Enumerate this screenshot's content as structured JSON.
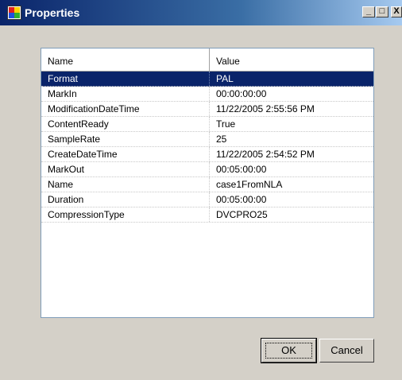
{
  "window": {
    "title": "Properties",
    "controls": {
      "minimize": "_",
      "maximize": "□",
      "close": "X"
    }
  },
  "grid": {
    "columns": [
      "Name",
      "Value"
    ],
    "rows": [
      {
        "name": "Format",
        "value": "PAL",
        "selected": true
      },
      {
        "name": "MarkIn",
        "value": "00:00:00:00"
      },
      {
        "name": "ModificationDateTime",
        "value": "11/22/2005 2:55:56 PM"
      },
      {
        "name": "ContentReady",
        "value": "True"
      },
      {
        "name": "SampleRate",
        "value": "25"
      },
      {
        "name": "CreateDateTime",
        "value": "11/22/2005 2:54:52 PM"
      },
      {
        "name": "MarkOut",
        "value": "00:05:00:00"
      },
      {
        "name": "Name",
        "value": "case1FromNLA"
      },
      {
        "name": "Duration",
        "value": "00:05:00:00"
      },
      {
        "name": "CompressionType",
        "value": "DVCPRO25"
      }
    ]
  },
  "buttons": {
    "ok": "OK",
    "cancel": "Cancel"
  },
  "colors": {
    "selection": "#0a246a",
    "dialog_bg": "#d4d0c8",
    "title_start": "#0a246a",
    "title_end": "#a6caf0"
  }
}
